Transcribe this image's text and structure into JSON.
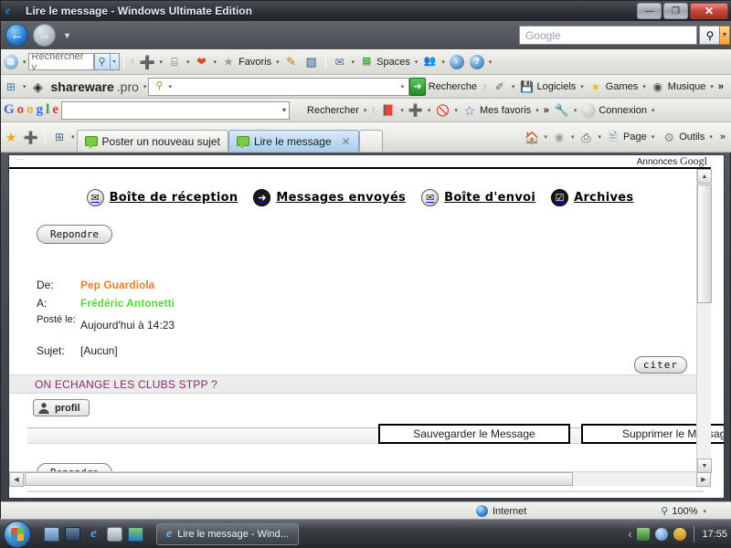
{
  "window": {
    "title": "Lire le message - Windows Ultimate Edition",
    "minimize_label": "—",
    "restore_label": "❐",
    "close_label": "✕"
  },
  "navband": {
    "back_label": "←",
    "forward_label": "→",
    "history_caret": "▼",
    "google_search_placeholder": "Google",
    "go_label": "⚲",
    "go_caret": "▼"
  },
  "toolbar1": {
    "windows_icon": "windows-logo-icon",
    "search_value": "Rechercher v",
    "search_button": "⚲",
    "search_caret": "▾",
    "add_label": "➕",
    "screen_label": "⌸",
    "fav_star": "★",
    "favoris_label": "Favoris",
    "pencil_label": "✎",
    "note_label": "▨",
    "mail_label": "✉",
    "spaces_label": "Spaces",
    "people_label": "👥",
    "messenger_label": "♁",
    "help_label": "?",
    "overflow_caret": "▾"
  },
  "toolbar2": {
    "plus_label": "⊞",
    "brand_logo": "shareware-gem-icon",
    "brand_name": "shareware",
    "brand_tld": ".pro",
    "search_icon": "magnifier-icon",
    "search_value": "",
    "go_label": "➜",
    "recherche_label": "Recherche",
    "eraser_label": "✐",
    "logiciels_label": "Logiciels",
    "games_label": "Games",
    "musique_label": "Musique",
    "overflow_label": "»"
  },
  "toolbar3": {
    "google_logo": "Google",
    "input_value": "",
    "rechercher_label": "Rechercher",
    "bookmarks_label": "📕",
    "plus_label": "➕",
    "block_label": "🚫",
    "favoris_star": "☆",
    "mes_favoris_label": "Mes favoris",
    "overflow_label": "»",
    "wrench_label": "🔧",
    "connexion_label": "Connexion"
  },
  "tabbar": {
    "fav_star": "★",
    "add_fav": "➕",
    "quicktabs": "⊞",
    "quicktabs_caret": "▾",
    "tabs": [
      {
        "label": "Poster un nouveau sujet",
        "active": false,
        "close": ""
      },
      {
        "label": "Lire le message",
        "active": true,
        "close": "✕"
      }
    ],
    "home_label": "🏠",
    "feeds_label": "◉",
    "print_label": "⎙",
    "page_label": "Page",
    "outils_label": "Outils",
    "overflow_label": "»"
  },
  "page": {
    "ads_left_text": "...",
    "ads_right_text": "Annonces",
    "ads_right_brand": "Googl",
    "folders": [
      {
        "icon": "inbox-icon",
        "glyph": "✉",
        "label": "Boîte de réception",
        "dark": false
      },
      {
        "icon": "sent-icon",
        "glyph": "➜",
        "label": "Messages envoyés",
        "dark": false
      },
      {
        "icon": "outbox-icon",
        "glyph": "✉",
        "label": "Boîte d'envoi",
        "dark": false
      },
      {
        "icon": "archive-icon",
        "glyph": "☑",
        "label": "Archives",
        "dark": true
      }
    ],
    "reply_top_label": "Repondre",
    "reply_bottom_label": "Repondre",
    "meta": {
      "from_label": "De:",
      "from_value": "Pep Guardiola",
      "to_label": "A:",
      "to_value": "Frédéric Antonetti",
      "posted_label": "Posté le:",
      "posted_value": "Aujourd'hui à 14:23",
      "subject_label": "Sujet:",
      "subject_value": "[Aucun]"
    },
    "cite_label": "citer",
    "body_text": "ON ECHANGE LES CLUBS STPP ?",
    "profil_label": "profil",
    "save_label": "Sauvegarder le Message",
    "delete_label": "Supprimer le Message",
    "scroll_up": "▲",
    "scroll_down": "▼",
    "scroll_left": "◀",
    "scroll_right": "▶"
  },
  "statusbar": {
    "zone_label": "Internet",
    "zoom_icon": "⚲",
    "zoom_label": "100%",
    "zoom_caret": "▾"
  },
  "taskbar": {
    "start_label": "start-orb",
    "quick_icons": [
      "show-desktop-icon",
      "desktop-switch-icon",
      "internet-explorer-icon",
      "folder-icon",
      "media-icon"
    ],
    "task_label": "Lire le message - Wind...",
    "tray_expand": "‹",
    "tray_icons": [
      "network-icon",
      "antivirus-icon",
      "update-icon"
    ],
    "clock": "17:55"
  },
  "colors": {
    "from_orange": "#e8821e",
    "to_green": "#55d93a",
    "body_magenta": "#8a2a6b",
    "title_blue": "#2f7fd0"
  }
}
